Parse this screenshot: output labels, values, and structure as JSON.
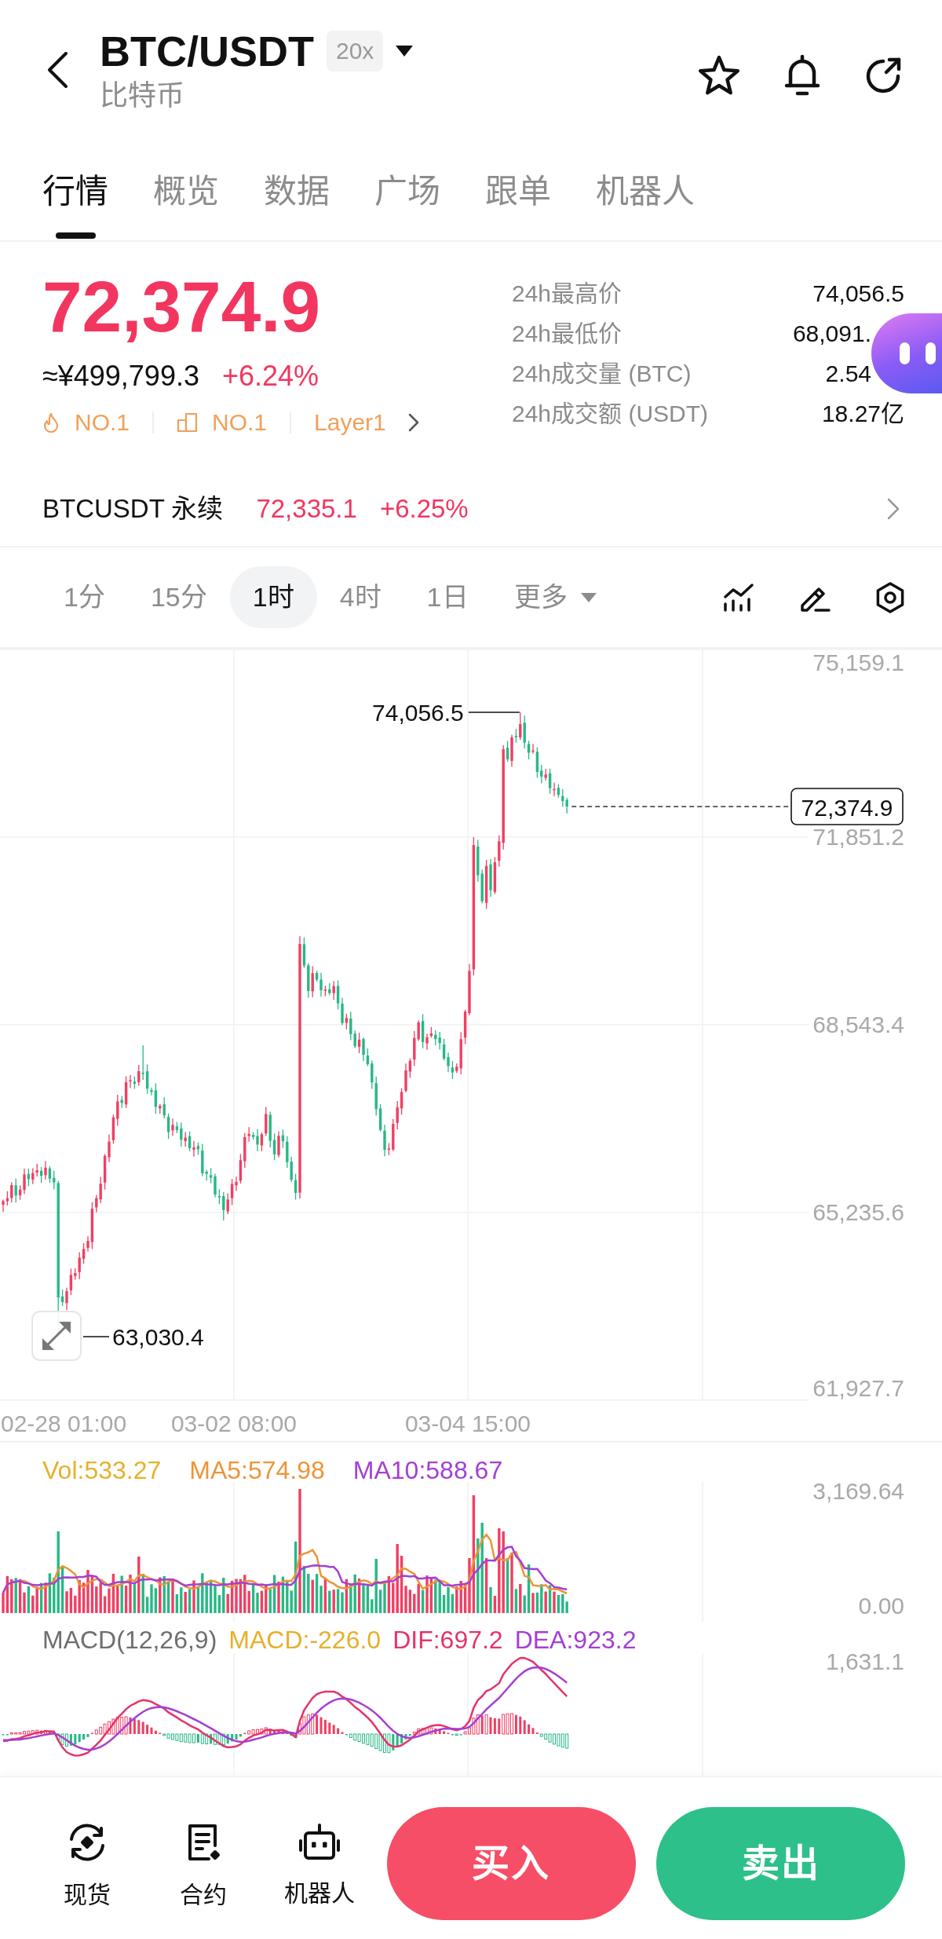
{
  "header": {
    "title": "BTC/USDT",
    "leverage": "20x",
    "subtitle": "比特币"
  },
  "tabs": [
    {
      "label": "行情",
      "selected": true
    },
    {
      "label": "概览",
      "selected": false
    },
    {
      "label": "数据",
      "selected": false
    },
    {
      "label": "广场",
      "selected": false
    },
    {
      "label": "跟单",
      "selected": false
    },
    {
      "label": "机器人",
      "selected": false
    }
  ],
  "ticker": {
    "price": "72,374.9",
    "fiat_price": "≈¥499,799.3",
    "change": "+6.24%",
    "tags": [
      {
        "kind": "hot",
        "label": "NO.1"
      },
      {
        "kind": "sector",
        "label": "NO.1"
      },
      {
        "kind": "category",
        "label": "Layer1"
      }
    ],
    "stats": [
      {
        "label": "24h最高价",
        "value": "74,056.5"
      },
      {
        "label": "24h最低价",
        "value": "68,091."
      },
      {
        "label": "24h成交量 (BTC)",
        "value": "2.54"
      },
      {
        "label": "24h成交额 (USDT)",
        "value": "18.27亿"
      }
    ]
  },
  "perpetual": {
    "name": "BTCUSDT 永续",
    "price": "72,335.1",
    "change": "+6.25%"
  },
  "intervals": [
    {
      "kind": "interval",
      "label": "1分",
      "selected": false
    },
    {
      "kind": "interval",
      "label": "15分",
      "selected": false
    },
    {
      "kind": "interval",
      "label": "1时",
      "selected": true
    },
    {
      "kind": "interval",
      "label": "4时",
      "selected": false
    },
    {
      "kind": "interval",
      "label": "1日",
      "selected": false
    },
    {
      "kind": "dropdown",
      "label": "更多",
      "selected": false
    }
  ],
  "chart": {
    "price_axis": [
      "75,159.1",
      "71,851.2",
      "68,543.4",
      "65,235.6",
      "61,927.7"
    ],
    "high_label": "74,056.5",
    "low_label": "63,030.4",
    "last_price": "72,374.9",
    "time_axis": [
      "02-28 01:00",
      "03-02 08:00",
      "03-04 15:00"
    ]
  },
  "volume": {
    "legend": [
      {
        "label": "Vol:533.27",
        "color": "#e5b02c"
      },
      {
        "label": "MA5:574.98",
        "color": "#ec9537"
      },
      {
        "label": "MA10:588.67",
        "color": "#a43fd4"
      }
    ],
    "axis": [
      "3,169.64",
      "0.00"
    ]
  },
  "macd": {
    "legend": [
      {
        "label": "MACD(12,26,9)",
        "color": "#6e6e6e"
      },
      {
        "label": "MACD:-226.0",
        "color": "#e5b02c"
      },
      {
        "label": "DIF:697.2",
        "color": "#e5336a"
      },
      {
        "label": "DEA:923.2",
        "color": "#a43fd4"
      }
    ],
    "axis": [
      "1,631.1"
    ]
  },
  "bottom_nav": [
    {
      "kind": "spot",
      "label": "现货"
    },
    {
      "kind": "futures",
      "label": "合约"
    },
    {
      "kind": "bot",
      "label": "机器人"
    }
  ],
  "actions": [
    {
      "kind": "buy",
      "label": "买入"
    },
    {
      "kind": "sell",
      "label": "卖出"
    }
  ]
}
